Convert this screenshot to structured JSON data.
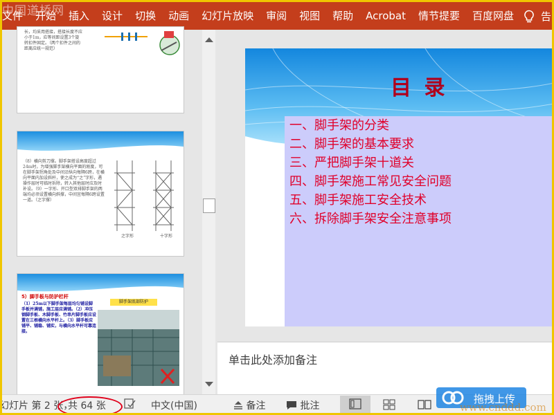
{
  "ribbon": {
    "watermark": "中国道桥网",
    "tabs": [
      "文件",
      "开始",
      "插入",
      "设计",
      "切换",
      "动画",
      "幻灯片放映",
      "审阅",
      "视图",
      "帮助",
      "Acrobat",
      "情节提要",
      "百度网盘"
    ],
    "tell_me": "告",
    "lightbulb_icon": "lightbulb-icon",
    "color": "#c43e1c"
  },
  "thumbnails": {
    "slide1": {
      "text": "长，均采用搭接，搭接长度不应小于1m，应等间距设置3个旋转扣件固定。（两个扣件之间的距离应统一规范）"
    },
    "slide2": {
      "text": "（8）横向剪刀撑。脚手架搭设高度超过24m时，为增强脚手架横向平面的刚度，可在脚手架拐角处及中间沿纵向每隔6跨，在横向平面内加设斜杆，使之成为“之”字形，遇操作层时可临时拆除，转入其他层时应及时补设。（9）一字形、开口型双排脚手架的两端均必须设置横向斜撑，中间宜每隔6跨设置一道。（之字撑）",
      "label_left": "之字形",
      "label_right": "十字形"
    },
    "slide3": {
      "heading": "5）脚手板与防护栏杆",
      "photo_label": "脚手架底部防护",
      "text": "（1）25m以下脚手架每层均匀铺设脚手板并满铺，施工层应满铺。（2）冲压钢脚手板、木脚手板、竹串片脚手板应设置在三根横向水平杆上。（3）脚手板应铺平、铺稳、铺实，与横向水平杆可靠连接。"
    }
  },
  "slide": {
    "title": "目    录",
    "toc": [
      "一、脚手架的分类",
      "二、脚手架的基本要求",
      "三、严把脚手架十道关",
      "四、脚手架施工常见安全问题",
      "五、脚手架施工安全技术",
      "六、拆除脚手架安全注意事项"
    ]
  },
  "notes": {
    "placeholder": "单击此处添加备注"
  },
  "status": {
    "slide_number": "幻灯片 第 2 张，",
    "slide_total": "共 64 张",
    "language": "中文(中国)",
    "notes_label": "备注",
    "comments_label": "批注",
    "notes_icon": "notes-icon",
    "comments_icon": "comments-icon",
    "accessibility_icon": "accessibility-check-icon"
  },
  "overlay": {
    "baidu_upload": "拖拽上传",
    "watermark": "www.cnddd.com"
  }
}
